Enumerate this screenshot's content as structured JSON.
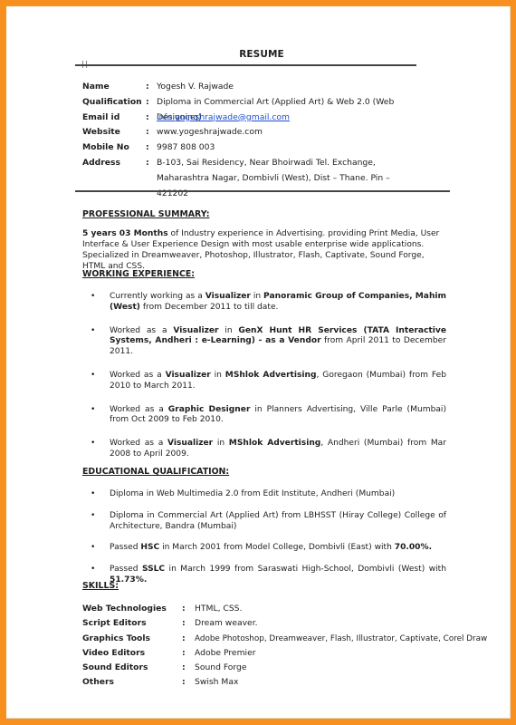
{
  "document": {
    "title": "RESUME",
    "colors": {
      "frame": "#f7901e",
      "link": "#1f4fd1"
    }
  },
  "contact": {
    "rows": [
      {
        "label": "Name",
        "value": "Yogesh V. Rajwade"
      },
      {
        "label": "Qualification",
        "value": "Diploma in Commercial Art (Applied Art) & Web 2.0 (Web Designing)"
      },
      {
        "label": "Email id",
        "value": "info.yogeshrajwade@gmail.com"
      },
      {
        "label": "Website",
        "value": "www.yogeshrajwade.com"
      },
      {
        "label": "Mobile No",
        "value": "9987 808 003"
      },
      {
        "label": "Address",
        "value": "B-103, Sai Residency, Near Bhoirwadi Tel. Exchange, Maharashtra Nagar, Dombivli (West), Dist – Thane. Pin – 421202"
      }
    ],
    "separator": ":"
  },
  "summary": {
    "heading": "PROFESSIONAL SUMMARY:",
    "lead_bold": "5  years 03 Months",
    "text": " of Industry experience in Advertising. providing Print Media, User Interface & User Experience Design with most usable enterprise wide applications. Specialized in Dreamweaver, Photoshop, Illustrator, Flash, Captivate, Sound Forge, HTML and CSS."
  },
  "experience": {
    "heading": "WORKING EXPERIENCE:",
    "items": [
      {
        "parts": [
          {
            "t": "Currently working as a ",
            "b": false
          },
          {
            "t": "Visualizer",
            "b": true
          },
          {
            "t": " in ",
            "b": false
          },
          {
            "t": "Panoramic Group of Companies, Mahim (West)",
            "b": true
          },
          {
            "t": " from December 2011 to till date.",
            "b": false
          }
        ]
      },
      {
        "parts": [
          {
            "t": "Worked as a ",
            "b": false
          },
          {
            "t": "Visualizer",
            "b": true
          },
          {
            "t": " in ",
            "b": false
          },
          {
            "t": "GenX Hunt HR Services (TATA Interactive Systems, Andheri : e-Learning) - as a Vendor",
            "b": true
          },
          {
            "t": " from April 2011 to December 2011.",
            "b": false
          }
        ]
      },
      {
        "parts": [
          {
            "t": "Worked as a ",
            "b": false
          },
          {
            "t": "Visualizer",
            "b": true
          },
          {
            "t": " in ",
            "b": false
          },
          {
            "t": "MShlok Advertising",
            "b": true
          },
          {
            "t": ", Goregaon (Mumbai) from Feb 2010 to March 2011.",
            "b": false
          }
        ]
      },
      {
        "parts": [
          {
            "t": "Worked as a ",
            "b": false
          },
          {
            "t": "Graphic Designer",
            "b": true
          },
          {
            "t": " in Planners Advertising, Ville Parle (Mumbai) from Oct 2009 to Feb 2010.",
            "b": false
          }
        ]
      },
      {
        "parts": [
          {
            "t": "Worked as a ",
            "b": false
          },
          {
            "t": "Visualizer",
            "b": true
          },
          {
            "t": " in ",
            "b": false
          },
          {
            "t": "MShlok Advertising",
            "b": true
          },
          {
            "t": ", Andheri (Mumbai) from Mar 2008 to April 2009.",
            "b": false
          }
        ]
      }
    ]
  },
  "education": {
    "heading": "EDUCATIONAL QUALIFICATION:",
    "items": [
      {
        "parts": [
          {
            "t": "Diploma in Web Multimedia 2.0 from Edit Institute, Andheri (Mumbai)",
            "b": false
          }
        ]
      },
      {
        "parts": [
          {
            "t": "Diploma in Commercial Art (Applied Art) from LBHSST (Hiray College) College of Architecture, Bandra (Mumbai)",
            "b": false
          }
        ]
      },
      {
        "parts": [
          {
            "t": "Passed ",
            "b": false
          },
          {
            "t": "HSC",
            "b": true
          },
          {
            "t": " in March 2001 from Model College, Dombivli (East) with ",
            "b": false
          },
          {
            "t": "70.00%.",
            "b": true
          }
        ]
      },
      {
        "parts": [
          {
            "t": "Passed ",
            "b": false
          },
          {
            "t": "SSLC",
            "b": true
          },
          {
            "t": " in March 1999 from Saraswati High-School, Dombivli (West) with ",
            "b": false
          },
          {
            "t": "51.73%.",
            "b": true
          }
        ]
      }
    ]
  },
  "skills": {
    "heading": "SKILLS:",
    "rows": [
      {
        "label": "Web Technologies",
        "value": "HTML, CSS."
      },
      {
        "label": "Script Editors",
        "value": "Dream weaver."
      },
      {
        "label": "Graphics Tools",
        "value": "Adobe Photoshop, Dreamweaver, Flash, Illustrator, Captivate, Corel Draw"
      },
      {
        "label": "Video Editors",
        "value": "Adobe Premier"
      },
      {
        "label": "Sound Editors",
        "value": "Sound Forge"
      },
      {
        "label": "Others",
        "value": "Swish Max"
      }
    ]
  },
  "bullet_glyph": "•"
}
